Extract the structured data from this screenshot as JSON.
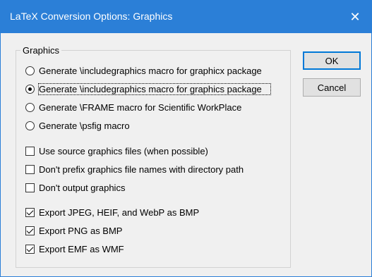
{
  "window": {
    "title": "LaTeX Conversion Options: Graphics",
    "close_symbol": "✕"
  },
  "group": {
    "label": "Graphics"
  },
  "radios": [
    {
      "label": "Generate \\includegraphics macro for graphicx package",
      "checked": false
    },
    {
      "label": "Generate \\includegraphics macro for graphics package",
      "checked": true
    },
    {
      "label": "Generate \\FRAME macro for Scientific WorkPlace",
      "checked": false
    },
    {
      "label": "Generate \\psfig macro",
      "checked": false
    }
  ],
  "checkboxes": [
    {
      "label": "Use source graphics files (when possible)",
      "checked": false
    },
    {
      "label": "Don't prefix graphics file names with directory path",
      "checked": false
    },
    {
      "label": "Don't output graphics",
      "checked": false
    },
    {
      "label": "Export JPEG, HEIF, and WebP as BMP",
      "checked": true
    },
    {
      "label": "Export PNG as BMP",
      "checked": true
    },
    {
      "label": "Export EMF as WMF",
      "checked": true
    }
  ],
  "buttons": {
    "ok": "OK",
    "cancel": "Cancel"
  }
}
